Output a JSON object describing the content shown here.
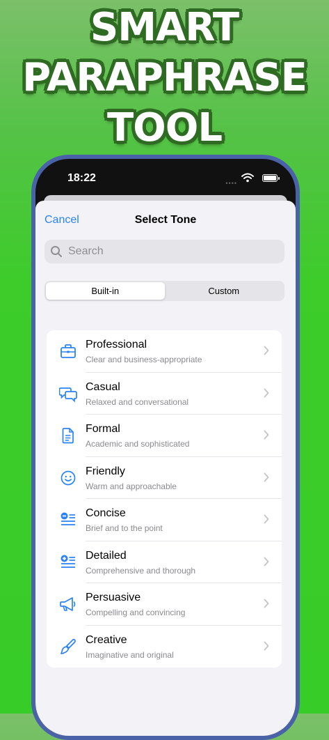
{
  "banner": {
    "line1": "SMART",
    "line2": "PARAPHRASE",
    "line3": "TOOL"
  },
  "status": {
    "time": "18:22"
  },
  "nav": {
    "cancel": "Cancel",
    "title": "Select Tone"
  },
  "search": {
    "placeholder": "Search",
    "value": ""
  },
  "segments": {
    "builtin": "Built-in",
    "custom": "Custom",
    "selected": "Built-in"
  },
  "tones": [
    {
      "label": "Professional",
      "desc": "Clear and business-appropriate",
      "icon": "briefcase-icon"
    },
    {
      "label": "Casual",
      "desc": "Relaxed and conversational",
      "icon": "chat-bubbles-icon"
    },
    {
      "label": "Formal",
      "desc": "Academic and sophisticated",
      "icon": "document-icon"
    },
    {
      "label": "Friendly",
      "desc": "Warm and approachable",
      "icon": "smiley-icon"
    },
    {
      "label": "Concise",
      "desc": "Brief and to the point",
      "icon": "minus-list-icon"
    },
    {
      "label": "Detailed",
      "desc": "Comprehensive and thorough",
      "icon": "plus-list-icon"
    },
    {
      "label": "Persuasive",
      "desc": "Compelling and convincing",
      "icon": "megaphone-icon"
    },
    {
      "label": "Creative",
      "desc": "Imaginative and original",
      "icon": "paintbrush-icon"
    }
  ],
  "colors": {
    "accent": "#2a83f6",
    "background": "#3dcc2a",
    "frame": "#4a63a8"
  }
}
